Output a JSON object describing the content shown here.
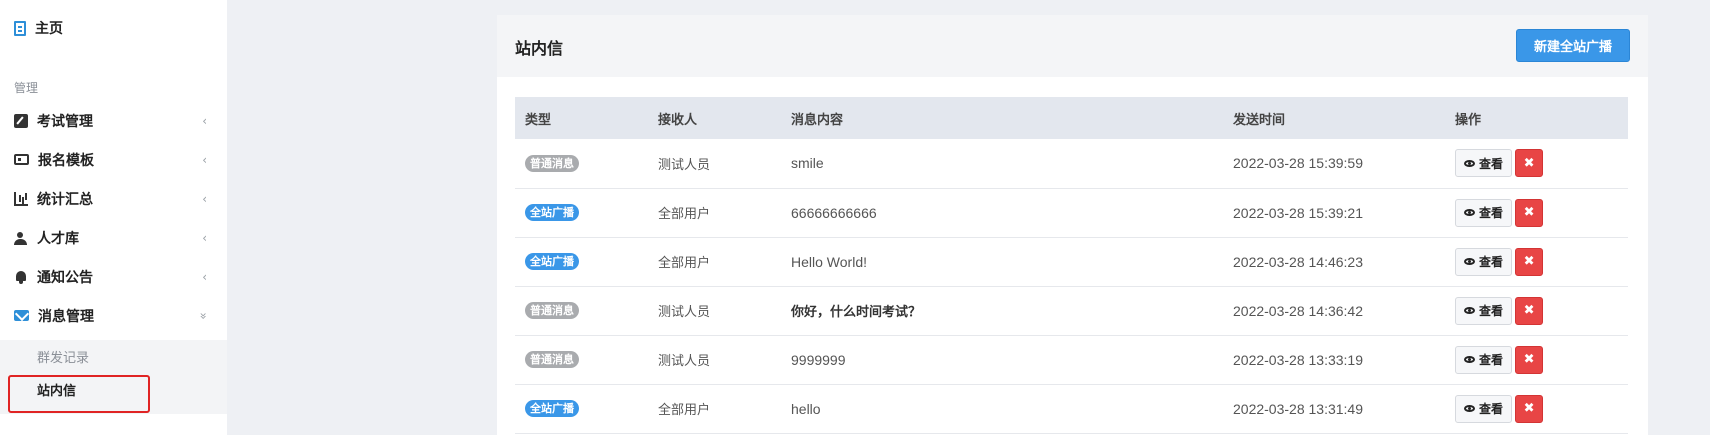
{
  "sidebar": {
    "home_label": "主页",
    "section_label": "管理",
    "items": [
      {
        "label": "考试管理",
        "icon": "pencil-square-icon",
        "chevron": "‹"
      },
      {
        "label": "报名模板",
        "icon": "id-card-icon",
        "chevron": "‹"
      },
      {
        "label": "统计汇总",
        "icon": "bar-chart-icon",
        "chevron": "‹"
      },
      {
        "label": "人才库",
        "icon": "users-icon",
        "chevron": "‹"
      },
      {
        "label": "通知公告",
        "icon": "bell-icon",
        "chevron": "‹"
      },
      {
        "label": "消息管理",
        "icon": "envelope-icon",
        "chevron": "»"
      }
    ],
    "submenu": [
      {
        "label": "群发记录"
      },
      {
        "label": "站内信",
        "active": true
      }
    ]
  },
  "panel": {
    "title": "站内信",
    "new_button_label": "新建全站广播"
  },
  "table": {
    "headers": [
      "类型",
      "接收人",
      "消息内容",
      "发送时间",
      "操作"
    ],
    "view_label": "查看",
    "delete_glyph": "✖",
    "rows": [
      {
        "type": "普通消息",
        "type_color": "gray",
        "receiver": "测试人员",
        "content": "smile",
        "bold": false,
        "time": "2022-03-28 15:39:59"
      },
      {
        "type": "全站广播",
        "type_color": "blue",
        "receiver": "全部用户",
        "content": "66666666666",
        "bold": false,
        "time": "2022-03-28 15:39:21"
      },
      {
        "type": "全站广播",
        "type_color": "blue",
        "receiver": "全部用户",
        "content": "Hello World!",
        "bold": false,
        "time": "2022-03-28 14:46:23"
      },
      {
        "type": "普通消息",
        "type_color": "gray",
        "receiver": "测试人员",
        "content": "你好，什么时间考试？",
        "bold": true,
        "time": "2022-03-28 14:36:42"
      },
      {
        "type": "普通消息",
        "type_color": "gray",
        "receiver": "测试人员",
        "content": "9999999",
        "bold": false,
        "time": "2022-03-28 13:33:19"
      },
      {
        "type": "全站广播",
        "type_color": "blue",
        "receiver": "全部用户",
        "content": "hello",
        "bold": false,
        "time": "2022-03-28 13:31:49"
      }
    ]
  },
  "colors": {
    "accent": "#3a97e8",
    "danger": "#e84545",
    "badge_gray": "#a9abae",
    "highlight": "#e02424"
  }
}
